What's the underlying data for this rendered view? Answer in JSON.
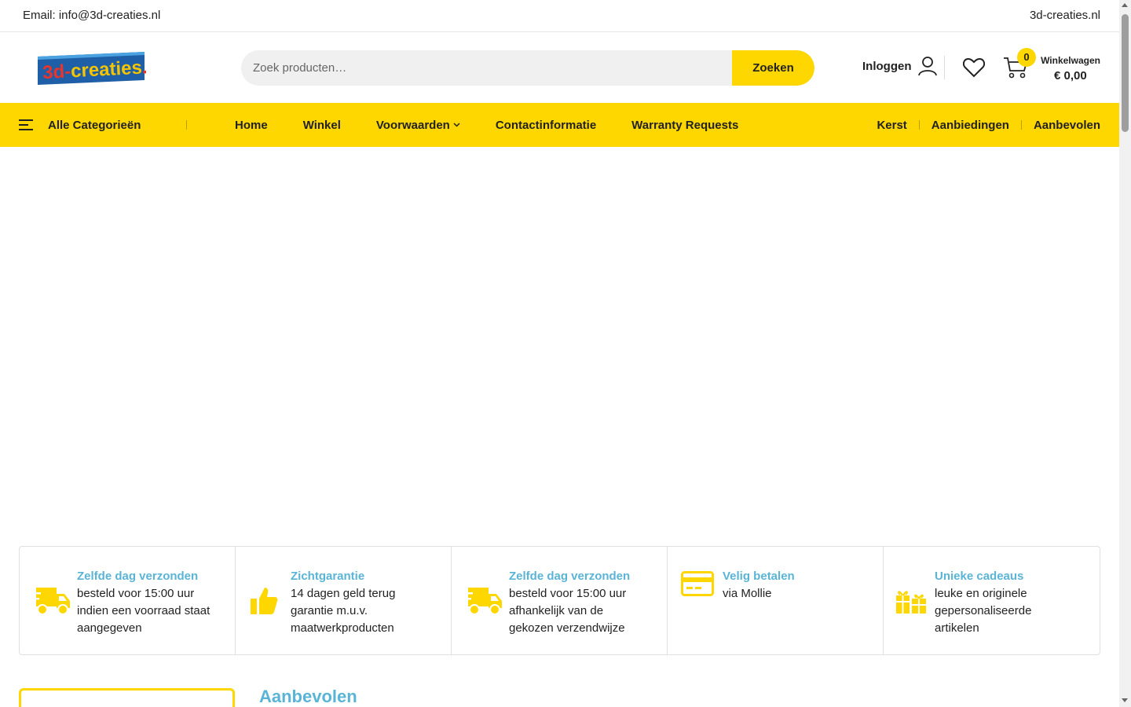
{
  "topbar": {
    "email": "Email: info@3d-creaties.nl",
    "site": "3d-creaties.nl"
  },
  "header": {
    "logo_text": "3d-creaties.nl",
    "search_placeholder": "Zoek producten…",
    "search_button": "Zoeken",
    "login_label": "Inloggen",
    "cart_count": "0",
    "cart_label": "Winkelwagen",
    "cart_total": "€ 0,00"
  },
  "nav": {
    "all_categories": "Alle Categorieën",
    "items": [
      "Home",
      "Winkel",
      "Voorwaarden",
      "Contactinformatie",
      "Warranty Requests"
    ],
    "right": [
      "Kerst",
      "Aanbiedingen",
      "Aanbevolen"
    ]
  },
  "features": [
    {
      "icon": "delivery-truck-icon",
      "title": "Zelfde dag verzonden",
      "lines": [
        "besteld voor 15:00 uur",
        "indien een voorraad staat",
        "aangegeven"
      ]
    },
    {
      "icon": "thumbs-up-icon",
      "title": "Zichtgarantie",
      "lines": [
        "14 dagen geld terug",
        "garantie m.u.v.",
        "maatwerkproducten"
      ]
    },
    {
      "icon": "delivery-truck-icon",
      "title": "Zelfde dag verzonden",
      "lines": [
        "besteld voor 15:00 uur",
        "afhankelijk van de",
        "gekozen verzendwijze"
      ]
    },
    {
      "icon": "credit-card-icon",
      "title": "Velig betalen",
      "lines": [
        "via Mollie"
      ]
    },
    {
      "icon": "gift-icon",
      "title": "Unieke cadeaus",
      "lines": [
        "leuke en originele",
        "gepersonaliseerde",
        "artikelen"
      ]
    }
  ],
  "section": {
    "title": "Aanbevolen"
  },
  "colors": {
    "accent": "#fed700",
    "feature_title": "#5ab4d6"
  }
}
